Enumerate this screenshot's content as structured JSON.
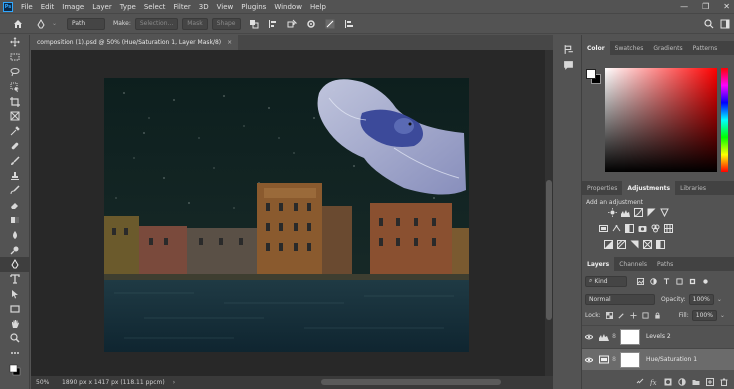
{
  "app": {
    "logo_text": "Ps"
  },
  "menu": [
    "File",
    "Edit",
    "Image",
    "Layer",
    "Type",
    "Select",
    "Filter",
    "3D",
    "View",
    "Plugins",
    "Window",
    "Help"
  ],
  "window_controls": {
    "minimize": "—",
    "restore": "❐",
    "close": "✕"
  },
  "options_bar": {
    "path_mode": "Path",
    "make_label": "Make:",
    "selection_btn": "Selection...",
    "mask_btn": "Mask",
    "shape_btn": "Shape"
  },
  "document": {
    "tab_title": "composition (1).psd @ 50% (Hue/Saturation 1, Layer Mask/8)",
    "tab_close": "×"
  },
  "status": {
    "zoom": "50%",
    "dimensions": "1890 px x 1417 px (118.11 ppcm)",
    "arrow": "›"
  },
  "color_panel": {
    "tabs": [
      "Color",
      "Swatches",
      "Gradients",
      "Patterns"
    ],
    "active_tab": "Color",
    "foreground": "#ffffff",
    "background": "#000000"
  },
  "adjustments_panel": {
    "tabs": [
      "Properties",
      "Adjustments",
      "Libraries"
    ],
    "active_tab": "Adjustments",
    "add_label": "Add an adjustment"
  },
  "layers_panel": {
    "tabs": [
      "Layers",
      "Channels",
      "Paths"
    ],
    "active_tab": "Layers",
    "filter_kind": "Kind",
    "blend_mode": "Normal",
    "opacity_label": "Opacity:",
    "opacity_value": "100%",
    "lock_label": "Lock:",
    "fill_label": "Fill:",
    "fill_value": "100%",
    "layers": [
      {
        "name": "Levels 2",
        "type": "levels",
        "selected": false
      },
      {
        "name": "Hue/Saturation 1",
        "type": "hue-saturation",
        "selected": true
      }
    ]
  },
  "colors": {
    "ui_bg": "#535353",
    "canvas_bg": "#282828",
    "accent": "#31a8ff"
  }
}
